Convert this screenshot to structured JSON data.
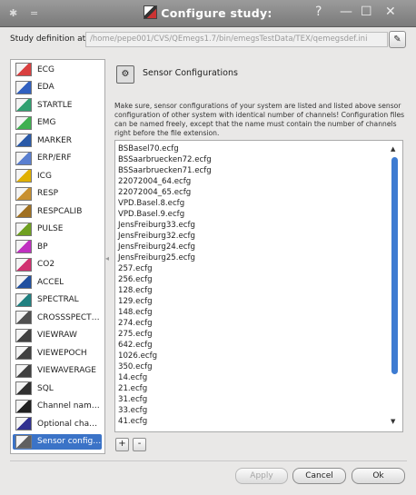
{
  "window": {
    "title": "Configure study:",
    "controls": {
      "help": "?",
      "minimize": "—",
      "maximize": "☐",
      "close": "✕"
    },
    "menu_glyph": "="
  },
  "study_definition": {
    "label": "Study definition at:",
    "path": "/home/pepe001/CVS/QEmegs1.7/bin/emegsTestData/TEX/qemegsdef.ini",
    "edit_icon": "edit-icon"
  },
  "sidebar": {
    "selected_index": 21,
    "items": [
      {
        "label": "ECG",
        "icon": "ecg-icon",
        "color": "#d94040"
      },
      {
        "label": "EDA",
        "icon": "eda-icon",
        "color": "#3060c0"
      },
      {
        "label": "STARTLE",
        "icon": "startle-icon",
        "color": "#30a070"
      },
      {
        "label": "EMG",
        "icon": "emg-icon",
        "color": "#40b050"
      },
      {
        "label": "MARKER",
        "icon": "marker-icon",
        "color": "#2a5aa8"
      },
      {
        "label": "ERP/ERF",
        "icon": "erp-icon",
        "color": "#5a7fd0"
      },
      {
        "label": "ICG",
        "icon": "icg-icon",
        "color": "#e0b000"
      },
      {
        "label": "RESP",
        "icon": "resp-icon",
        "color": "#c89030"
      },
      {
        "label": "RESPCALIB",
        "icon": "respcalib-icon",
        "color": "#a07020"
      },
      {
        "label": "PULSE",
        "icon": "pulse-icon",
        "color": "#6fa020"
      },
      {
        "label": "BP",
        "icon": "bp-icon",
        "color": "#c030c0"
      },
      {
        "label": "CO2",
        "icon": "co2-icon",
        "color": "#d03070"
      },
      {
        "label": "ACCEL",
        "icon": "accel-icon",
        "color": "#2050a0"
      },
      {
        "label": "SPECTRAL",
        "icon": "spectral-icon",
        "color": "#208080"
      },
      {
        "label": "CROSSSPECTRAL",
        "icon": "crossspectral-icon",
        "color": "#505050"
      },
      {
        "label": "VIEWRAW",
        "icon": "viewraw-icon",
        "color": "#404040"
      },
      {
        "label": "VIEWEPOCH",
        "icon": "viewepoch-icon",
        "color": "#404040"
      },
      {
        "label": "VIEWAVERAGE",
        "icon": "viewaverage-icon",
        "color": "#404040"
      },
      {
        "label": "SQL",
        "icon": "sql-icon",
        "color": "#303030"
      },
      {
        "label": "Channel naming",
        "icon": "channel-naming-icon",
        "color": "#202020"
      },
      {
        "label": "Optional channels",
        "icon": "optional-channels-icon",
        "color": "#303090"
      },
      {
        "label": "Sensor configurations",
        "icon": "sensor-config-icon",
        "color": "#606060"
      }
    ]
  },
  "panel": {
    "title": "Sensor Configurations",
    "description": "Make sure, sensor configurations of your system are listed and listed above sensor configuration of other system with identical number of channels! Configuration files can be named freely, except that the name must contain the number of channels right before the file extension.",
    "files": [
      "BSBasel70.ecfg",
      "BSSaarbruecken72.ecfg",
      "BSSaarbruecken71.ecfg",
      "22072004_64.ecfg",
      "22072004_65.ecfg",
      "VPD.Basel.8.ecfg",
      "VPD.Basel.9.ecfg",
      "JensFreiburg33.ecfg",
      "JensFreiburg32.ecfg",
      "JensFreiburg24.ecfg",
      "JensFreiburg25.ecfg",
      "257.ecfg",
      "256.ecfg",
      "128.ecfg",
      "129.ecfg",
      "148.ecfg",
      "274.ecfg",
      "275.ecfg",
      "642.ecfg",
      "1026.ecfg",
      "350.ecfg",
      "14.ecfg",
      "21.ecfg",
      "31.ecfg",
      "33.ecfg",
      "41.ecfg"
    ],
    "add_label": "+",
    "remove_label": "-"
  },
  "buttons": {
    "apply": "Apply",
    "cancel": "Cancel",
    "ok": "Ok"
  }
}
